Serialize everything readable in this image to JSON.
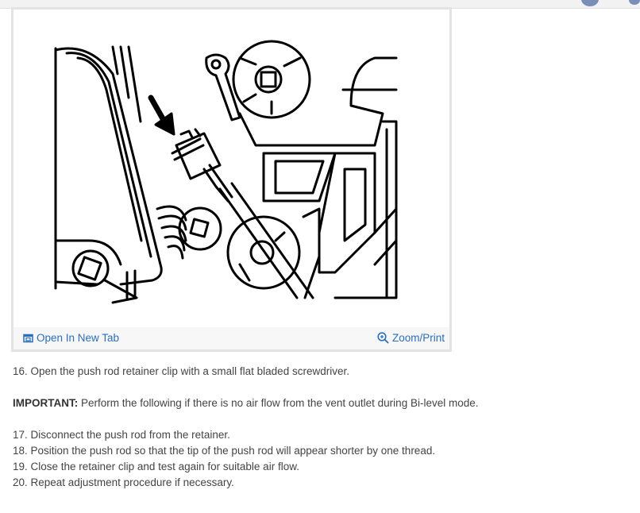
{
  "figure": {
    "open_link_label": "Open In New Tab",
    "zoom_link_label": "Zoom/Print"
  },
  "steps": {
    "step16": "16. Open the push rod retainer clip with a small flat bladed screwdriver.",
    "important_label": "IMPORTANT:",
    "important_text": " Perform the following if there is no air flow from the vent outlet during Bi-level mode.",
    "step17": "17. Disconnect the push rod from the retainer.",
    "step18": "18. Position the push rod so that the tip of the push rod will appear shorter by one thread.",
    "step19": "19. Close the retainer clip and test again for suitable air flow.",
    "step20": "20. Repeat adjustment procedure if necessary."
  },
  "colors": {
    "link": "#2a6ebb",
    "text": "#444444",
    "card_border": "#e3e3e3"
  }
}
